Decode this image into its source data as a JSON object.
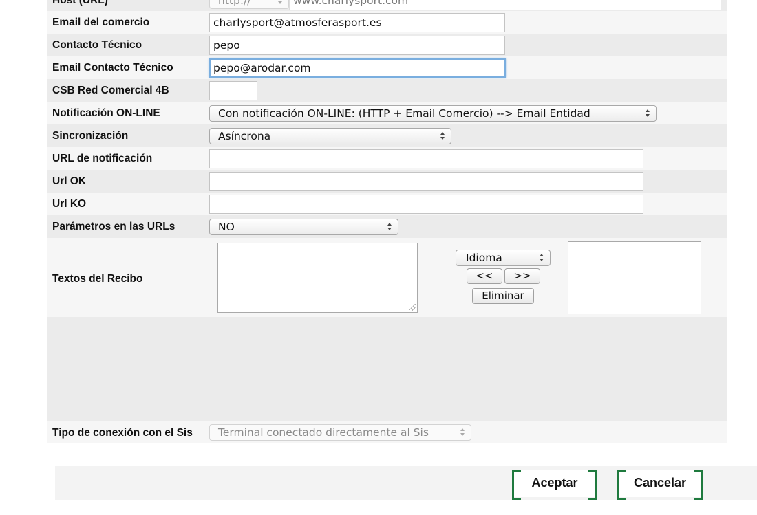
{
  "form": {
    "host": {
      "label": "Host (URL)",
      "protocol": "http://",
      "value": "www.charlysport.com"
    },
    "email_comercio": {
      "label": "Email del comercio",
      "value": "charlysport@atmosferasport.es"
    },
    "contacto_tecnico": {
      "label": "Contacto Técnico",
      "value": "pepo"
    },
    "email_contacto_tecnico": {
      "label": "Email Contacto Técnico",
      "value": "pepo@arodar.com"
    },
    "csb_red_comercial": {
      "label": "CSB Red Comercial 4B",
      "value": ""
    },
    "notificacion_online": {
      "label": "Notificación ON-LINE",
      "selected": "Con notificación ON-LINE: (HTTP + Email Comercio) --> Email Entidad"
    },
    "sincronizacion": {
      "label": "Sincronización",
      "selected": "Asíncrona"
    },
    "url_notificacion": {
      "label": "URL de notificación",
      "value": ""
    },
    "url_ok": {
      "label": "Url OK",
      "value": ""
    },
    "url_ko": {
      "label": "Url KO",
      "value": ""
    },
    "parametros_urls": {
      "label": "Parámetros en las URLs",
      "selected": "NO"
    },
    "textos_recibo": {
      "label": "Textos del Recibo",
      "idioma": "Idioma",
      "prev": "<<",
      "next": ">>",
      "eliminar": "Eliminar"
    },
    "tipo_conexion": {
      "label": "Tipo de conexión con el Sis",
      "selected": "Terminal conectado directamente al Sis"
    }
  },
  "actions": {
    "accept": "Aceptar",
    "cancel": "Cancelar"
  },
  "colors": {
    "action_border": "#1f7a3e",
    "focus_ring": "#7aaedf"
  }
}
